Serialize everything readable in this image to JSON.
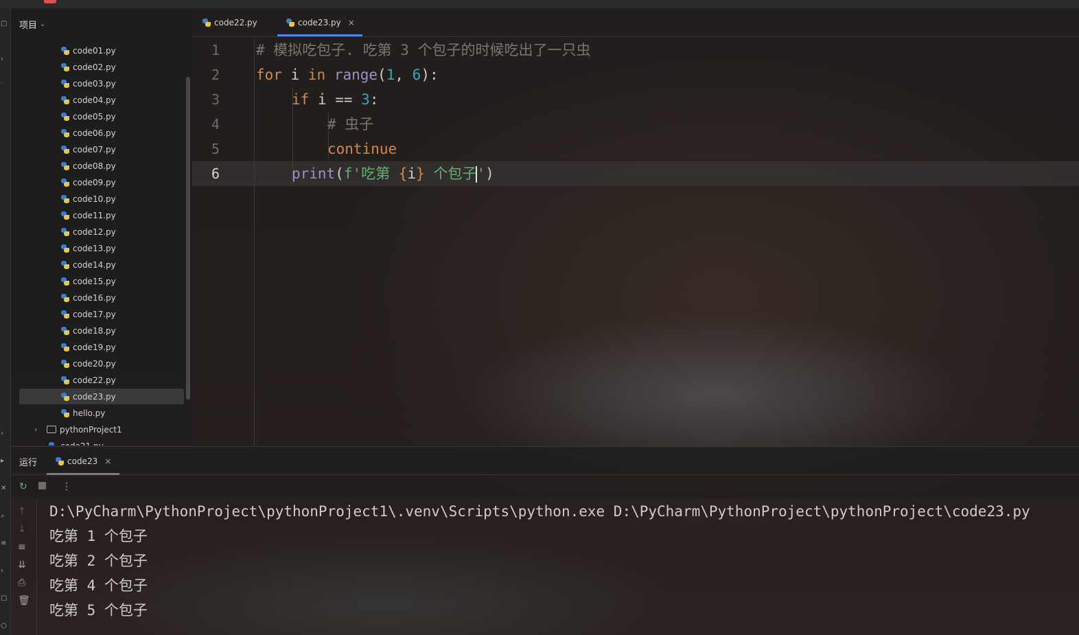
{
  "project_panel": {
    "title": "项目",
    "files": [
      "code01.py",
      "code02.py",
      "code03.py",
      "code04.py",
      "code05.py",
      "code06.py",
      "code07.py",
      "code08.py",
      "code09.py",
      "code10.py",
      "code11.py",
      "code12.py",
      "code13.py",
      "code14.py",
      "code15.py",
      "code16.py",
      "code17.py",
      "code18.py",
      "code19.py",
      "code20.py",
      "code22.py",
      "code23.py",
      "hello.py"
    ],
    "selected_file": "code23.py",
    "folder": "pythonProject1",
    "partial_file": "code21.py"
  },
  "tabs": [
    {
      "label": "code22.py",
      "active": false
    },
    {
      "label": "code23.py",
      "active": true,
      "close": "×"
    }
  ],
  "editor": {
    "line_numbers": [
      "1",
      "2",
      "3",
      "4",
      "5",
      "6"
    ],
    "current_line": 6,
    "comment1": "# 模拟吃包子. 吃第 3 个包子的时候吃出了一只虫",
    "l2_for": "for",
    "l2_i": " i ",
    "l2_in": "in",
    "l2_sp": " ",
    "l2_range": "range",
    "l2_open": "(",
    "l2_n1": "1",
    "l2_comma": ", ",
    "l2_n6": "6",
    "l2_close": "):",
    "l3_if": "if",
    "l3_mid": " i == ",
    "l3_n3": "3",
    "l3_colon": ":",
    "comment4": "# 虫子",
    "l5_continue": "continue",
    "l6_print": "print",
    "l6_open": "(",
    "l6_f": "f'吃第 ",
    "l6_brace_o": "{",
    "l6_i": "i",
    "l6_brace_c": "}",
    "l6_str_end": " 个包子",
    "l6_quote": "'",
    "l6_close": ")"
  },
  "run_panel": {
    "title": "运行",
    "tab_label": "code23",
    "tab_close": "×",
    "more": "⋮",
    "console_lines": [
      "D:\\PyCharm\\PythonProject\\pythonProject1\\.venv\\Scripts\\python.exe D:\\PyCharm\\PythonProject\\pythonProject\\code23.py",
      "吃第 1 个包子",
      "吃第 2 个包子",
      "吃第 4 个包子",
      "吃第 5 个包子"
    ]
  },
  "colors": {
    "keyword": "#d08a4a",
    "function": "#9c91c8",
    "number": "#3fa6b4",
    "string": "#6aab73",
    "comment": "#7a7571",
    "tab_active": "#4b86e8"
  }
}
